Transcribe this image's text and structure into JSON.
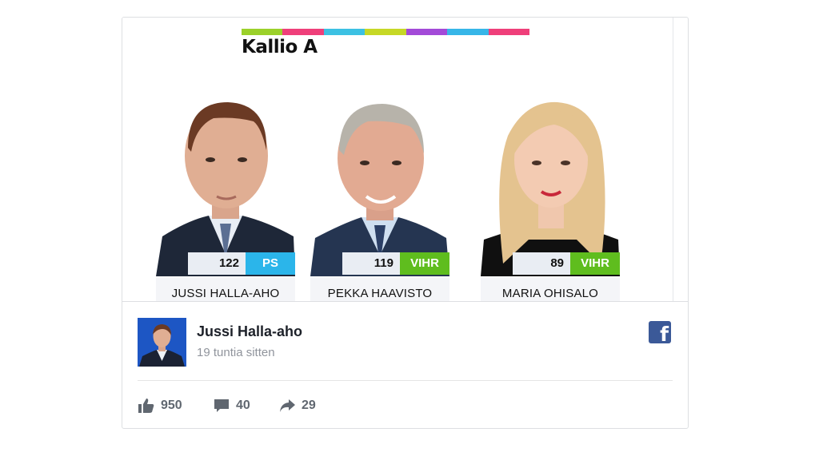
{
  "image": {
    "district": "Kallio A",
    "color_bar": [
      "#9bd12a",
      "#ef3f7a",
      "#3cc1e3",
      "#c6d826",
      "#a34ad8",
      "#37b6e8",
      "#ef3f7a"
    ],
    "candidates": [
      {
        "votes": "122",
        "party": "PS",
        "party_color": "#2bb5ea",
        "name": "JUSSI HALLA-AHO"
      },
      {
        "votes": "119",
        "party": "VIHR",
        "party_color": "#5fbd1e",
        "name": "PEKKA HAAVISTO"
      },
      {
        "votes": "89",
        "party": "VIHR",
        "party_color": "#5fbd1e",
        "name": "MARIA OHISALO"
      }
    ]
  },
  "post": {
    "author": "Jussi Halla-aho",
    "time": "19 tuntia sitten",
    "platform_icon": "facebook-icon",
    "likes": "950",
    "comments": "40",
    "shares": "29"
  }
}
